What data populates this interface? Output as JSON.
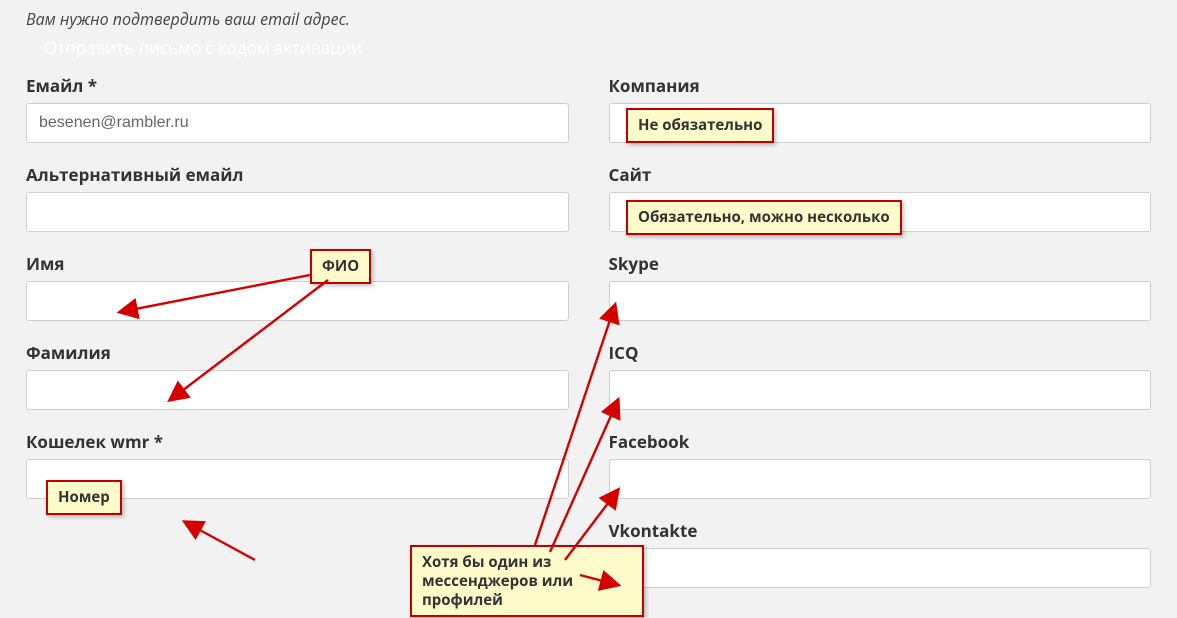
{
  "notice": "Вам нужно подтвердить ваш email адрес.",
  "activation_link": "Отправить письмо с кодом активации",
  "left": {
    "email": {
      "label": "Емайл *",
      "value": "besenen@rambler.ru"
    },
    "alt_email": {
      "label": "Альтернативный емайл",
      "value": ""
    },
    "first_name": {
      "label": "Имя",
      "value": ""
    },
    "last_name": {
      "label": "Фамилия",
      "value": ""
    },
    "wmr": {
      "label": "Кошелек wmr *",
      "value": ""
    }
  },
  "right": {
    "company": {
      "label": "Компания",
      "value": ""
    },
    "site": {
      "label": "Сайт",
      "value": ""
    },
    "skype": {
      "label": "Skype",
      "value": ""
    },
    "icq": {
      "label": "ICQ",
      "value": ""
    },
    "facebook": {
      "label": "Facebook",
      "value": ""
    },
    "vkontakte": {
      "label": "Vkontakte",
      "value": ""
    }
  },
  "callouts": {
    "fio": "ФИО",
    "nomer": "Номер",
    "not_required": "Не обязательно",
    "required_multiple": "Обязательно, можно несколько",
    "messenger_note": "Хотя бы один из мессенджеров или профилей"
  }
}
